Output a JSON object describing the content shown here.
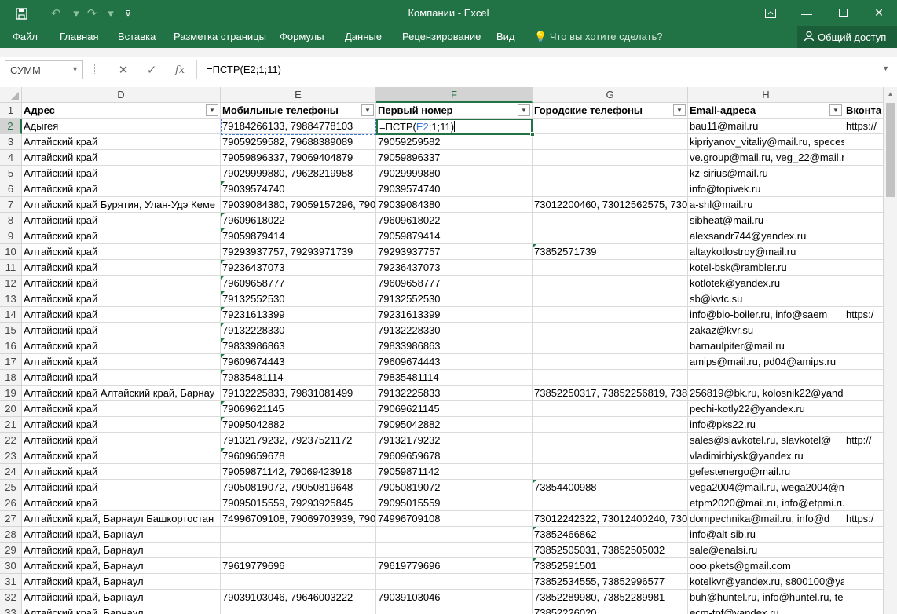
{
  "window": {
    "title": "Компании - Excel"
  },
  "ribbon": {
    "tabs": [
      "Файл",
      "Главная",
      "Вставка",
      "Разметка страницы",
      "Формулы",
      "Данные",
      "Рецензирование",
      "Вид"
    ],
    "tell_me": "Что вы хотите сделать?",
    "share": "Общий доступ"
  },
  "formula_bar": {
    "name_box": "СУММ",
    "formula": "=ПСТР(E2;1;11)",
    "fx": "fx"
  },
  "sheet": {
    "columns": [
      "D",
      "E",
      "F",
      "G",
      "H"
    ],
    "selected_column": "F",
    "header_row": {
      "D": "Адрес",
      "E": "Мобильные телефоны",
      "F": "Первый номер",
      "G": "Городские телефоны",
      "H": "Email-адреса",
      "I": "Вконта"
    },
    "editing_cell": {
      "prefix": "=ПСТР(",
      "ref": "E2",
      "suffix": ";1;11)"
    },
    "rows": [
      {
        "n": "1"
      },
      {
        "n": "2",
        "D": "Адыгея",
        "E": "79184266133, 79884778103",
        "F": "",
        "G": "",
        "H": "bau11@mail.ru",
        "I": "https://"
      },
      {
        "n": "3",
        "D": "Алтайский край",
        "E": "79059259582, 79688389089",
        "F": "79059259582",
        "G": "",
        "H": "kipriyanov_vitaliy@mail.ru, specesfera",
        "I": ""
      },
      {
        "n": "4",
        "D": "Алтайский край",
        "E": "79059896337, 79069404879",
        "F": "79059896337",
        "G": "",
        "H": "ve.group@mail.ru, veg_22@mail.ru",
        "I": ""
      },
      {
        "n": "5",
        "D": "Алтайский край",
        "E": "79029999880, 79628219988",
        "F": "79029999880",
        "G": "",
        "H": "kz-sirius@mail.ru",
        "I": ""
      },
      {
        "n": "6",
        "D": "Алтайский край",
        "E": "79039574740",
        "F": "79039574740",
        "G": "",
        "H": "info@topivek.ru",
        "I": ""
      },
      {
        "n": "7",
        "D": "Алтайский край Бурятия, Улан-Удэ Кеме",
        "E": "79039084380, 79059157296, 7905",
        "F": "79039084380",
        "G": "73012200460, 73012562575, 7301",
        "H": "a-shl@mail.ru",
        "I": ""
      },
      {
        "n": "8",
        "D": "Алтайский край",
        "E": "79609618022",
        "F": "79609618022",
        "G": "",
        "H": "sibheat@mail.ru",
        "I": ""
      },
      {
        "n": "9",
        "D": "Алтайский край",
        "E": "79059879414",
        "F": "79059879414",
        "G": "",
        "H": "alexsandr744@yandex.ru",
        "I": ""
      },
      {
        "n": "10",
        "D": "Алтайский край",
        "E": "79293937757, 79293971739",
        "F": "79293937757",
        "G": "73852571739",
        "H": "altaykotlostroy@mail.ru",
        "I": ""
      },
      {
        "n": "11",
        "D": "Алтайский край",
        "E": "79236437073",
        "F": "79236437073",
        "G": "",
        "H": "kotel-bsk@rambler.ru",
        "I": ""
      },
      {
        "n": "12",
        "D": "Алтайский край",
        "E": "79609658777",
        "F": "79609658777",
        "G": "",
        "H": "kotlotek@yandex.ru",
        "I": ""
      },
      {
        "n": "13",
        "D": "Алтайский край",
        "E": "79132552530",
        "F": "79132552530",
        "G": "",
        "H": "sb@kvtc.su",
        "I": ""
      },
      {
        "n": "14",
        "D": "Алтайский край",
        "E": "79231613399",
        "F": "79231613399",
        "G": "",
        "H": "info@bio-boiler.ru, info@saem",
        "I": "https:/"
      },
      {
        "n": "15",
        "D": "Алтайский край",
        "E": "79132228330",
        "F": "79132228330",
        "G": "",
        "H": "zakaz@kvr.su",
        "I": ""
      },
      {
        "n": "16",
        "D": "Алтайский край",
        "E": "79833986863",
        "F": "79833986863",
        "G": "",
        "H": "barnaulpiter@mail.ru",
        "I": ""
      },
      {
        "n": "17",
        "D": "Алтайский край",
        "E": "79609674443",
        "F": "79609674443",
        "G": "",
        "H": "amips@mail.ru, pd04@amips.ru",
        "I": ""
      },
      {
        "n": "18",
        "D": "Алтайский край",
        "E": "79835481114",
        "F": "79835481114",
        "G": "",
        "H": "",
        "I": ""
      },
      {
        "n": "19",
        "D": "Алтайский край Алтайский край, Барнау",
        "E": "79132225833, 79831081499",
        "F": "79132225833",
        "G": "73852250317, 73852256819, 7385",
        "H": "256819@bk.ru, kolosnik22@yandex.ru",
        "I": ""
      },
      {
        "n": "20",
        "D": "Алтайский край",
        "E": "79069621145",
        "F": "79069621145",
        "G": "",
        "H": "pechi-kotly22@yandex.ru",
        "I": ""
      },
      {
        "n": "21",
        "D": "Алтайский край",
        "E": "79095042882",
        "F": "79095042882",
        "G": "",
        "H": "info@pks22.ru",
        "I": ""
      },
      {
        "n": "22",
        "D": "Алтайский край",
        "E": "79132179232, 79237521172",
        "F": "79132179232",
        "G": "",
        "H": "sales@slavkotel.ru, slavkotel@",
        "I": "http://"
      },
      {
        "n": "23",
        "D": "Алтайский край",
        "E": "79609659678",
        "F": "79609659678",
        "G": "",
        "H": "vladimirbiysk@yandex.ru",
        "I": ""
      },
      {
        "n": "24",
        "D": "Алтайский край",
        "E": "79059871142, 79069423918",
        "F": "79059871142",
        "G": "",
        "H": "gefestenergo@mail.ru",
        "I": ""
      },
      {
        "n": "25",
        "D": "Алтайский край",
        "E": "79050819072, 79050819648",
        "F": "79050819072",
        "G": "73854400988",
        "H": "vega2004@mail.ru, wega2004@mail.ru",
        "I": ""
      },
      {
        "n": "26",
        "D": "Алтайский край",
        "E": "79095015559, 79293925845",
        "F": "79095015559",
        "G": "",
        "H": "etpm2020@mail.ru, info@etpmi.ru",
        "I": ""
      },
      {
        "n": "27",
        "D": "Алтайский край, Барнаул Башкортостан",
        "E": "74996709108, 79069703939, 7909",
        "F": "74996709108",
        "G": "73012242322, 73012400240, 7301",
        "H": "dompechnika@mail.ru, info@d",
        "I": "https:/"
      },
      {
        "n": "28",
        "D": "Алтайский край, Барнаул",
        "E": "",
        "F": "",
        "G": "73852466862",
        "H": "info@alt-sib.ru",
        "I": ""
      },
      {
        "n": "29",
        "D": "Алтайский край, Барнаул",
        "E": "",
        "F": "",
        "G": "73852505031, 73852505032",
        "H": "sale@enalsi.ru",
        "I": ""
      },
      {
        "n": "30",
        "D": "Алтайский край, Барнаул",
        "E": "79619779696",
        "F": "79619779696",
        "G": "73852591501",
        "H": "ooo.pkets@gmail.com",
        "I": ""
      },
      {
        "n": "31",
        "D": "Алтайский край, Барнаул",
        "E": "",
        "F": "",
        "G": "73852534555, 73852996577",
        "H": "kotelkvr@yandex.ru, s800100@yandex.",
        "I": ""
      },
      {
        "n": "32",
        "D": "Алтайский край, Барнаул",
        "E": "79039103046, 79646003222",
        "F": "79039103046",
        "G": "73852289980, 73852289981",
        "H": "buh@huntel.ru, info@huntel.ru, teh@",
        "I": ""
      },
      {
        "n": "33",
        "D": "Алтайский край, Барнаул",
        "E": "",
        "F": "",
        "G": "73852226020",
        "H": "ecm-tpf@yandex.ru",
        "I": ""
      }
    ],
    "green_triangles": {
      "E": [
        "6",
        "8",
        "9",
        "11",
        "12",
        "13",
        "14",
        "15",
        "16",
        "17",
        "18",
        "20",
        "21",
        "23"
      ],
      "G": [
        "10",
        "25",
        "28",
        "30"
      ]
    }
  }
}
